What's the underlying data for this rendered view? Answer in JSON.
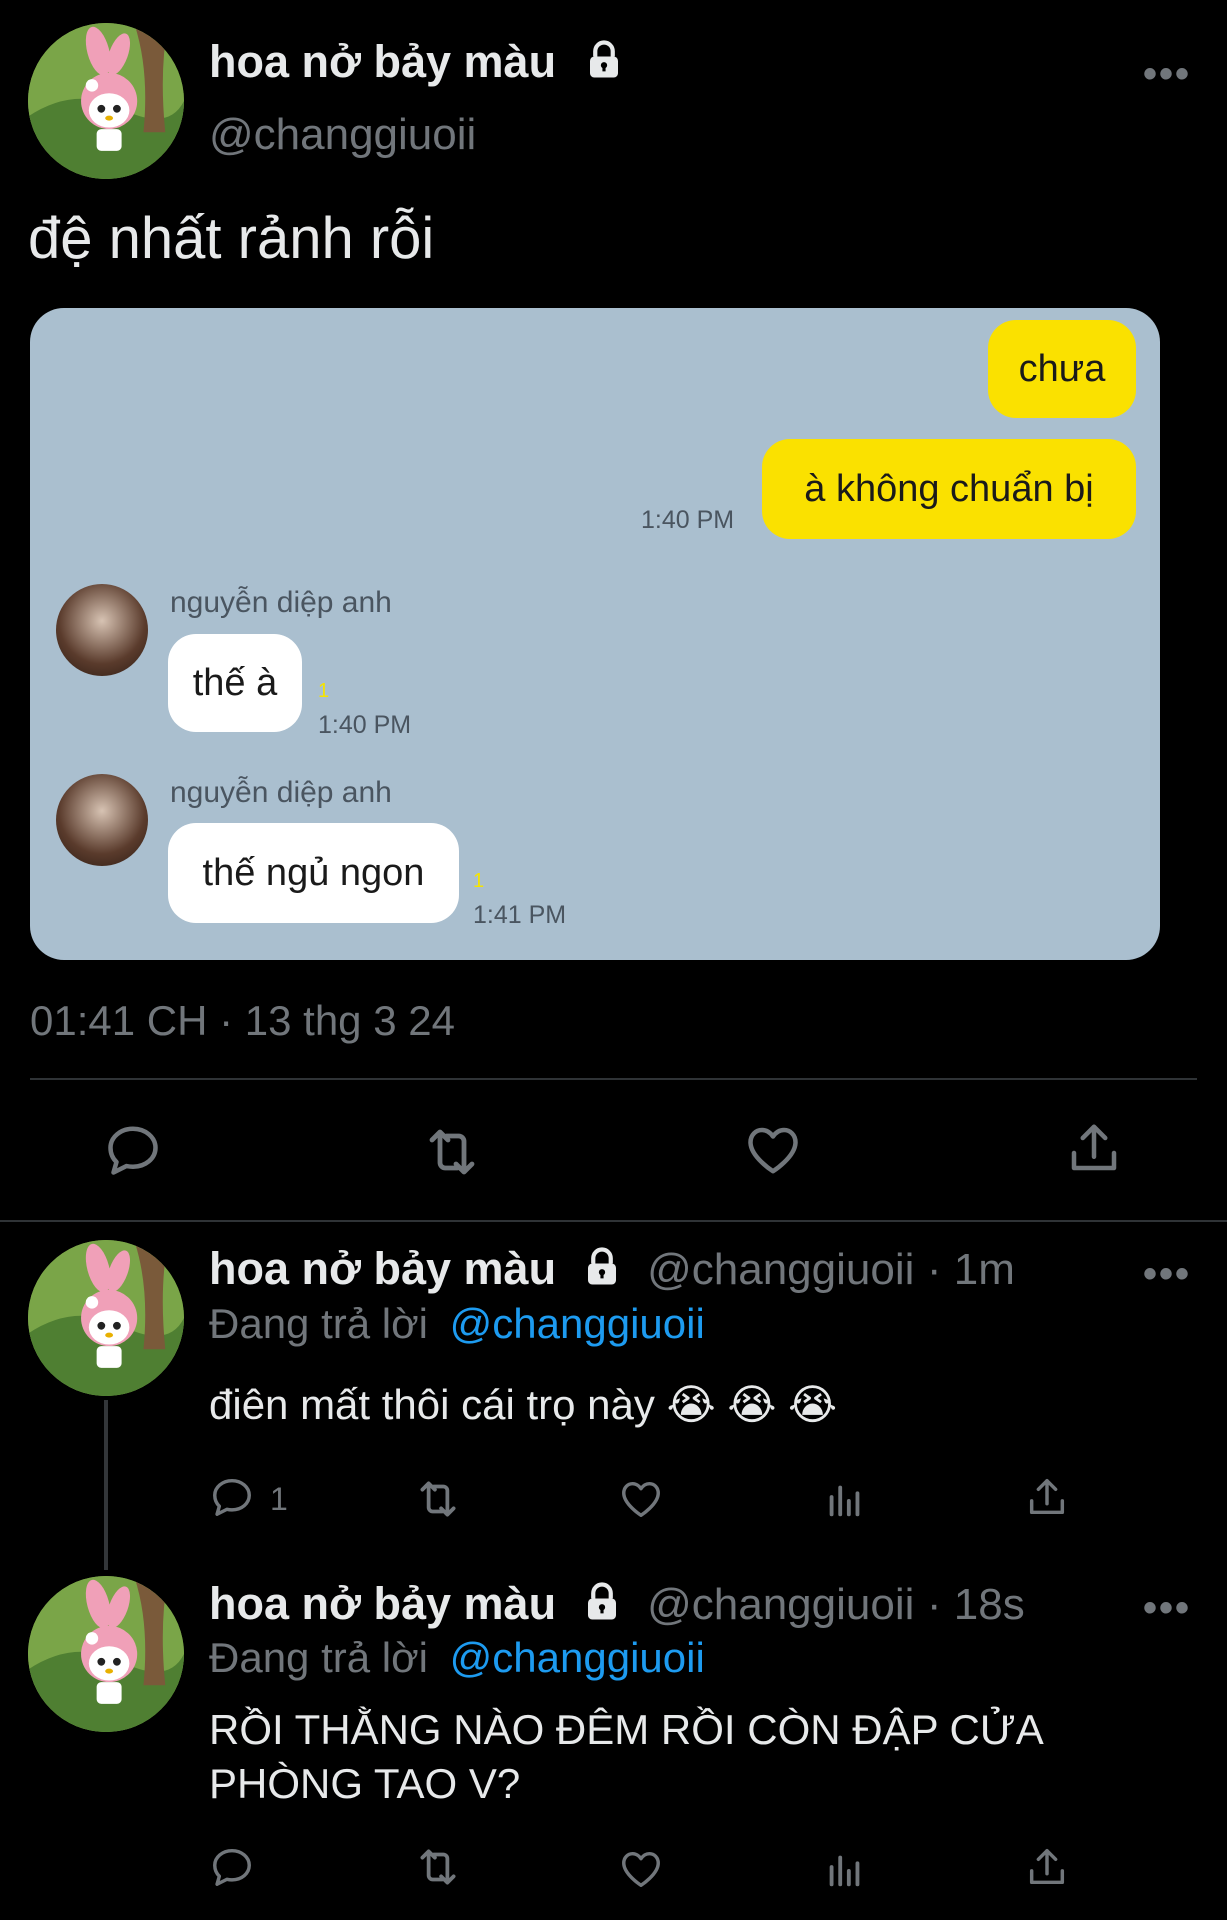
{
  "main_tweet": {
    "display_name": "hoa nở bảy màu",
    "handle": "@changgiuoii",
    "text": "đệ nhất rảnh rỗi",
    "timestamp": "01:41 CH · 13 thg 3 24",
    "icons": {
      "lock": "lock-icon",
      "more": "more-icon"
    }
  },
  "chat_image": {
    "messages": [
      {
        "from": "me",
        "text": "chưa"
      },
      {
        "from": "me",
        "text": "à không chuẩn bị",
        "time": "1:40 PM"
      },
      {
        "from": "other",
        "sender": "nguyễn diệp anh",
        "text": "thế à",
        "unread": "1",
        "time": "1:40 PM"
      },
      {
        "from": "other",
        "sender": "nguyễn diệp anh",
        "text": "thế ngủ ngon",
        "unread": "1",
        "time": "1:41 PM"
      }
    ],
    "colors": {
      "background": "#aabfcf",
      "my_bubble": "#fae100",
      "their_bubble": "#ffffff"
    }
  },
  "actions": [
    "reply-icon",
    "retweet-icon",
    "like-icon",
    "share-icon"
  ],
  "replies": [
    {
      "display_name": "hoa nở bảy màu",
      "handle": "@changgiuoii",
      "time": "1m",
      "replying_label": "Đang trả lời",
      "replying_to": "@changgiuoii",
      "text": "điên mất thôi cái trọ này 😭 😭 😭",
      "reply_count": "1"
    },
    {
      "display_name": "hoa nở bảy màu",
      "handle": "@changgiuoii",
      "time": "18s",
      "replying_label": "Đang trả lời",
      "replying_to": "@changgiuoii",
      "text_line1": "RỒI THẰNG NÀO ĐÊM RỒI CÒN ĐẬP CỬA",
      "text_line2": "PHÒNG TAO V?"
    }
  ],
  "colors": {
    "background": "#000000",
    "text": "#e7e9ea",
    "muted": "#71767b",
    "accent": "#1d9bf0"
  }
}
